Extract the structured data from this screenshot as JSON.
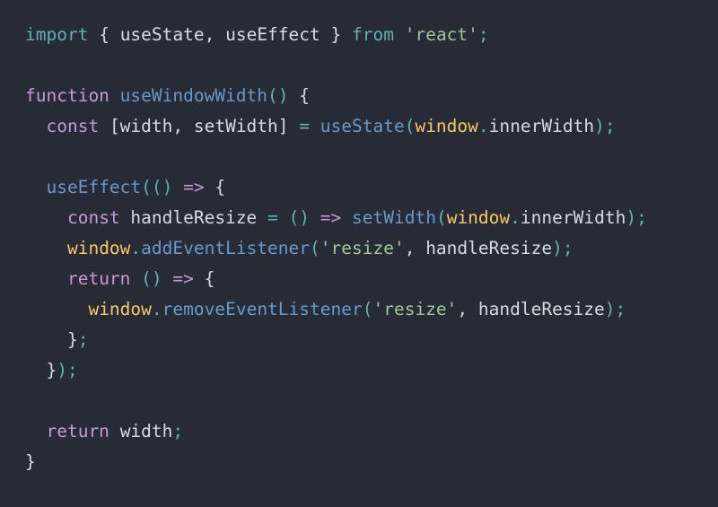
{
  "editor": {
    "language": "javascript",
    "background_color": "#272b35",
    "default_text_color": "#d5dae3",
    "font_size_px": 19.5,
    "line_height_px": 34,
    "theme_colors": {
      "keyword_import": "#5fb3b3",
      "keyword_declaration": "#c998d4",
      "function_name": "#6699cc",
      "global_object": "#fac863",
      "string": "#9cc792",
      "punctuation": "#5fb3b3",
      "plain": "#d5dae3"
    }
  },
  "lines": [
    {
      "number": 1,
      "indent": "",
      "tokens": [
        {
          "text": "import",
          "kind": "t-kw"
        },
        {
          "text": " ",
          "kind": "t-plain"
        },
        {
          "text": "{",
          "kind": "t-plain"
        },
        {
          "text": " useState, useEffect ",
          "kind": "t-plain"
        },
        {
          "text": "}",
          "kind": "t-plain"
        },
        {
          "text": " ",
          "kind": "t-plain"
        },
        {
          "text": "from",
          "kind": "t-kw"
        },
        {
          "text": " ",
          "kind": "t-plain"
        },
        {
          "text": "'react'",
          "kind": "t-str"
        },
        {
          "text": ";",
          "kind": "t-punc"
        }
      ]
    },
    {
      "number": 2,
      "indent": "",
      "tokens": []
    },
    {
      "number": 3,
      "indent": "",
      "tokens": [
        {
          "text": "function",
          "kind": "t-kw2"
        },
        {
          "text": " ",
          "kind": "t-plain"
        },
        {
          "text": "useWindowWidth",
          "kind": "t-fn"
        },
        {
          "text": "()",
          "kind": "t-punc"
        },
        {
          "text": " ",
          "kind": "t-plain"
        },
        {
          "text": "{",
          "kind": "t-plain"
        }
      ]
    },
    {
      "number": 4,
      "indent": "  ",
      "tokens": [
        {
          "text": "const",
          "kind": "t-kw2"
        },
        {
          "text": " ",
          "kind": "t-plain"
        },
        {
          "text": "[width, setWidth]",
          "kind": "t-plain"
        },
        {
          "text": " ",
          "kind": "t-plain"
        },
        {
          "text": "=",
          "kind": "t-punc"
        },
        {
          "text": " ",
          "kind": "t-plain"
        },
        {
          "text": "useState",
          "kind": "t-fn"
        },
        {
          "text": "(",
          "kind": "t-punc"
        },
        {
          "text": "window",
          "kind": "t-var"
        },
        {
          "text": ".",
          "kind": "t-punc"
        },
        {
          "text": "innerWidth",
          "kind": "t-plain"
        },
        {
          "text": ")",
          "kind": "t-punc"
        },
        {
          "text": ";",
          "kind": "t-punc"
        }
      ]
    },
    {
      "number": 5,
      "indent": "",
      "tokens": []
    },
    {
      "number": 6,
      "indent": "  ",
      "tokens": [
        {
          "text": "useEffect",
          "kind": "t-fn"
        },
        {
          "text": "(()",
          "kind": "t-punc"
        },
        {
          "text": " ",
          "kind": "t-plain"
        },
        {
          "text": "=>",
          "kind": "t-kw2"
        },
        {
          "text": " ",
          "kind": "t-plain"
        },
        {
          "text": "{",
          "kind": "t-plain"
        }
      ]
    },
    {
      "number": 7,
      "indent": "    ",
      "tokens": [
        {
          "text": "const",
          "kind": "t-kw2"
        },
        {
          "text": " ",
          "kind": "t-plain"
        },
        {
          "text": "handleResize",
          "kind": "t-plain"
        },
        {
          "text": " ",
          "kind": "t-plain"
        },
        {
          "text": "=",
          "kind": "t-punc"
        },
        {
          "text": " ",
          "kind": "t-plain"
        },
        {
          "text": "()",
          "kind": "t-punc"
        },
        {
          "text": " ",
          "kind": "t-plain"
        },
        {
          "text": "=>",
          "kind": "t-kw2"
        },
        {
          "text": " ",
          "kind": "t-plain"
        },
        {
          "text": "setWidth",
          "kind": "t-fn"
        },
        {
          "text": "(",
          "kind": "t-punc"
        },
        {
          "text": "window",
          "kind": "t-var"
        },
        {
          "text": ".",
          "kind": "t-punc"
        },
        {
          "text": "innerWidth",
          "kind": "t-plain"
        },
        {
          "text": ")",
          "kind": "t-punc"
        },
        {
          "text": ";",
          "kind": "t-punc"
        }
      ]
    },
    {
      "number": 8,
      "indent": "    ",
      "tokens": [
        {
          "text": "window",
          "kind": "t-var"
        },
        {
          "text": ".",
          "kind": "t-punc"
        },
        {
          "text": "addEventListener",
          "kind": "t-fn"
        },
        {
          "text": "(",
          "kind": "t-punc"
        },
        {
          "text": "'resize'",
          "kind": "t-str"
        },
        {
          "text": ",",
          "kind": "t-plain"
        },
        {
          "text": " ",
          "kind": "t-plain"
        },
        {
          "text": "handleResize",
          "kind": "t-plain"
        },
        {
          "text": ")",
          "kind": "t-punc"
        },
        {
          "text": ";",
          "kind": "t-punc"
        }
      ]
    },
    {
      "number": 9,
      "indent": "    ",
      "tokens": [
        {
          "text": "return",
          "kind": "t-kw2"
        },
        {
          "text": " ",
          "kind": "t-plain"
        },
        {
          "text": "()",
          "kind": "t-punc"
        },
        {
          "text": " ",
          "kind": "t-plain"
        },
        {
          "text": "=>",
          "kind": "t-kw2"
        },
        {
          "text": " ",
          "kind": "t-plain"
        },
        {
          "text": "{",
          "kind": "t-plain"
        }
      ]
    },
    {
      "number": 10,
      "indent": "      ",
      "tokens": [
        {
          "text": "window",
          "kind": "t-var"
        },
        {
          "text": ".",
          "kind": "t-punc"
        },
        {
          "text": "removeEventListener",
          "kind": "t-fn"
        },
        {
          "text": "(",
          "kind": "t-punc"
        },
        {
          "text": "'resize'",
          "kind": "t-str"
        },
        {
          "text": ",",
          "kind": "t-plain"
        },
        {
          "text": " ",
          "kind": "t-plain"
        },
        {
          "text": "handleResize",
          "kind": "t-plain"
        },
        {
          "text": ")",
          "kind": "t-punc"
        },
        {
          "text": ";",
          "kind": "t-punc"
        }
      ]
    },
    {
      "number": 11,
      "indent": "    ",
      "tokens": [
        {
          "text": "}",
          "kind": "t-plain"
        },
        {
          "text": ";",
          "kind": "t-punc"
        }
      ]
    },
    {
      "number": 12,
      "indent": "  ",
      "tokens": [
        {
          "text": "}",
          "kind": "t-plain"
        },
        {
          "text": ")",
          "kind": "t-punc"
        },
        {
          "text": ";",
          "kind": "t-punc"
        }
      ]
    },
    {
      "number": 13,
      "indent": "",
      "tokens": []
    },
    {
      "number": 14,
      "indent": "  ",
      "tokens": [
        {
          "text": "return",
          "kind": "t-kw2"
        },
        {
          "text": " ",
          "kind": "t-plain"
        },
        {
          "text": "width",
          "kind": "t-plain"
        },
        {
          "text": ";",
          "kind": "t-punc"
        }
      ]
    },
    {
      "number": 15,
      "indent": "",
      "tokens": [
        {
          "text": "}",
          "kind": "t-plain"
        }
      ]
    }
  ],
  "plain_text": "import { useState, useEffect } from 'react';\n\nfunction useWindowWidth() {\n  const [width, setWidth] = useState(window.innerWidth);\n\n  useEffect(() => {\n    const handleResize = () => setWidth(window.innerWidth);\n    window.addEventListener('resize', handleResize);\n    return () => {\n      window.removeEventListener('resize', handleResize);\n    };\n  });\n\n  return width;\n}"
}
